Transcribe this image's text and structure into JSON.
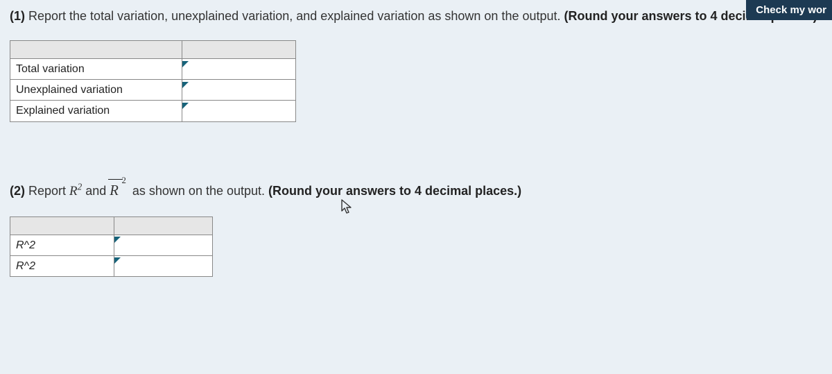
{
  "header": {
    "check_label": "Check my wor"
  },
  "q1": {
    "num": "(1)",
    "text_a": " Report the total variation, unexplained variation, and explained variation as shown on the output. ",
    "text_b": "(Round your answers to 4 decimal places.)",
    "rows": [
      {
        "label": "Total variation",
        "value": ""
      },
      {
        "label": "Unexplained variation",
        "value": ""
      },
      {
        "label": "Explained variation",
        "value": ""
      }
    ]
  },
  "q2": {
    "num": "(2)",
    "text_a": " Report ",
    "r2_plain": "R",
    "r2_sup": "2",
    "text_b": " and ",
    "rbar_R": "R",
    "rbar_exp": "2",
    "text_c": " as shown on the output. ",
    "text_d": "(Round your answers to 4 decimal places.)",
    "rows": [
      {
        "label": "R^2",
        "value": ""
      },
      {
        "label": "R^2",
        "value": ""
      }
    ]
  },
  "icons": {
    "cursor": "cursor-icon"
  }
}
